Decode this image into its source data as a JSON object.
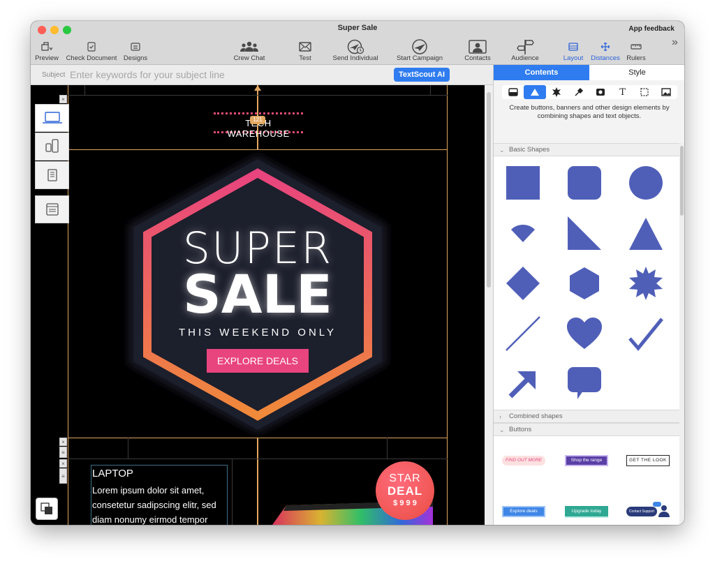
{
  "window": {
    "title": "Super Sale",
    "feedback": "App feedback"
  },
  "toolbar": {
    "preview": "Preview",
    "check_document": "Check Document",
    "designs": "Designs",
    "crew_chat": "Crew Chat",
    "test": "Test",
    "send_individual": "Send Individual",
    "start_campaign": "Start Campaign",
    "contacts": "Contacts",
    "audience": "Audience",
    "layout": "Layout",
    "distances": "Distances",
    "rulers": "Rulers",
    "more": "»"
  },
  "subject": {
    "label": "Subject",
    "placeholder": "Enter keywords for your subject line",
    "ai_button": "TextScout AI"
  },
  "canvas": {
    "brand": "TECH WAREHOUSE",
    "badge": "121",
    "hero_line1": "SUPER",
    "hero_line2": "SALE",
    "hero_sub": "THIS WEEKEND ONLY",
    "cta": "EXPLORE DEALS",
    "product_title": "LAPTOP",
    "product_body": "Lorem ipsum dolor sit amet, consetetur sadipscing elitr, sed diam nonumy eirmod tempor",
    "star_deal_1": "STAR",
    "star_deal_2": "DEAL",
    "star_deal_price": "$ 9 9 9"
  },
  "panel": {
    "tabs": {
      "contents": "Contents",
      "style": "Style"
    },
    "description": "Create buttons, banners and other design elements by combining shapes and text objects.",
    "sections": {
      "basic_shapes": "Basic Shapes",
      "combined_shapes": "Combined shapes",
      "buttons": "Buttons"
    },
    "buttons": {
      "find_out_more": "FIND OUT MORE",
      "shop_range": "Shop the range",
      "get_look": "GET THE LOOK",
      "explore_deals": "Explore deals",
      "upgrade_today": "Upgrade today",
      "contact_support": "Contact Support"
    },
    "text_tool": "T"
  },
  "colors": {
    "accent": "#2f7cf0",
    "shape": "#4f5fb8",
    "guide": "#e2a862",
    "pink": "#e8447e",
    "orange": "#f08a3a"
  }
}
